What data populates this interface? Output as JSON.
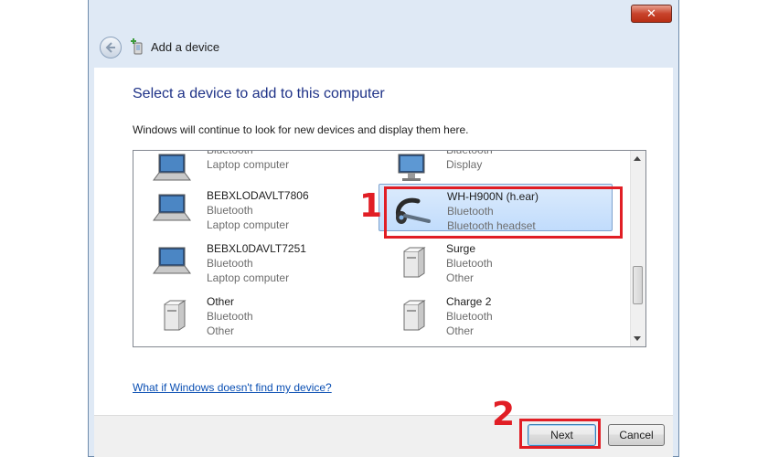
{
  "window": {
    "close_label": "✕",
    "title": "Add a device"
  },
  "content": {
    "heading": "Select a device to add to this computer",
    "description": "Windows will continue to look for new devices and display them here.",
    "help_link": "What if Windows doesn't find my device?"
  },
  "devices": [
    {
      "name": "",
      "connection": "Bluetooth",
      "type": "Laptop computer",
      "icon": "laptop-icon"
    },
    {
      "name": "",
      "connection": "Bluetooth",
      "type": "Display",
      "icon": "monitor-icon"
    },
    {
      "name": "BEBXLODAVLT7806",
      "connection": "Bluetooth",
      "type": "Laptop computer",
      "icon": "laptop-icon"
    },
    {
      "name": "WH-H900N (h.ear)",
      "connection": "Bluetooth",
      "type": "Bluetooth headset",
      "icon": "headset-icon"
    },
    {
      "name": "BEBXL0DAVLT7251",
      "connection": "Bluetooth",
      "type": "Laptop computer",
      "icon": "laptop-icon"
    },
    {
      "name": "Surge",
      "connection": "Bluetooth",
      "type": "Other",
      "icon": "device-tower-icon"
    },
    {
      "name": "Other",
      "connection": "Bluetooth",
      "type": "Other",
      "icon": "device-tower-icon"
    },
    {
      "name": "Charge 2",
      "connection": "Bluetooth",
      "type": "Other",
      "icon": "device-tower-icon"
    }
  ],
  "buttons": {
    "next": "Next",
    "cancel": "Cancel"
  },
  "annotations": {
    "step1": "1",
    "step2": "2",
    "color": "#e11e25"
  }
}
